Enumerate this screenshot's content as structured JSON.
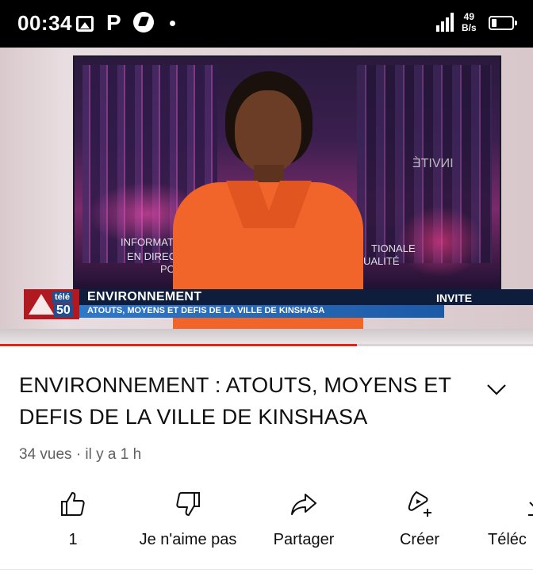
{
  "status_bar": {
    "time": "00:34",
    "net_speed_value": "49",
    "net_speed_unit": "B/s",
    "icons": [
      "gallery-icon",
      "p-app-icon",
      "bird-app-icon",
      "dot-icon",
      "signal-icon",
      "battery-icon"
    ]
  },
  "video": {
    "background_texts": [
      "INFORMAT",
      "EN DIREC",
      "PO",
      "TIONALE",
      "UALITÉ"
    ],
    "background_mirror_text": "INVITÉ",
    "lower_third": {
      "channel_brand": "télé",
      "channel_number": "50",
      "title": "ENVIRONNEMENT",
      "subtitle": "ATOUTS, MOYENS ET DEFIS DE LA VILLE DE KINSHASA",
      "tag": "INVITE"
    },
    "progress": 0.67,
    "accent_color": "#e62117"
  },
  "info": {
    "title": "ENVIRONNEMENT : ATOUTS, MOYENS ET DEFIS DE LA VILLE DE KINSHASA",
    "meta": "34 vues · il y a 1 h"
  },
  "actions": [
    {
      "icon": "thumbs-up-icon",
      "label": "1"
    },
    {
      "icon": "thumbs-down-icon",
      "label": "Je n'aime pas"
    },
    {
      "icon": "share-icon",
      "label": "Partager"
    },
    {
      "icon": "remix-icon",
      "label": "Créer"
    },
    {
      "icon": "download-icon",
      "label": "Téléc"
    }
  ]
}
